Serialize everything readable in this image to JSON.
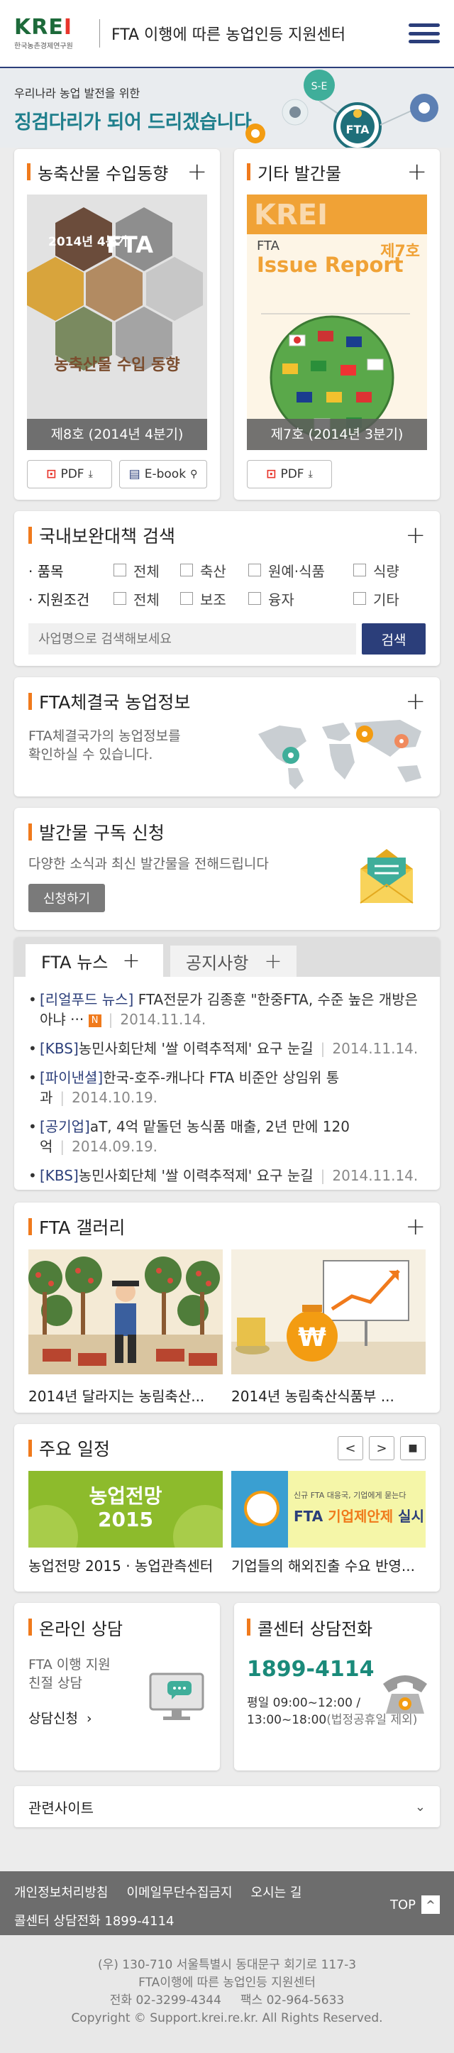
{
  "header": {
    "logo_mark": "KRE",
    "logo_mark_i": "I",
    "logo_sub": "한국농촌경제연구원",
    "title": "FTA 이행에 따른 농업인등 지원센터"
  },
  "hero": {
    "subtitle": "우리나라 농업 발전을 위한",
    "headline": "징검다리가 되어 드리겠습니다.",
    "badge": "FTA"
  },
  "import_trend": {
    "title": "농축산물 수입동향",
    "cover_main": "농축산물 수입 동향",
    "cover_quarter": "2014년 4분기",
    "cover_brand": "FTA",
    "caption": "제8호 (2014년 4분기)",
    "pdf_label": "PDF",
    "ebook_label": "E-book"
  },
  "publications": {
    "title": "기타 발간물",
    "cover_logo": "KREI",
    "cover_fta": "FTA",
    "cover_issue": "Issue Report",
    "cover_num": "제7호",
    "caption": "제7호 (2014년 3분기)",
    "pdf_label": "PDF"
  },
  "search": {
    "title": "국내보완대책 검색",
    "row1_label": "품목",
    "row1_options": [
      "전체",
      "축산",
      "원예·식품",
      "식량"
    ],
    "row2_label": "지원조건",
    "row2_options": [
      "전체",
      "보조",
      "융자",
      "기타"
    ],
    "placeholder": "사업명으로 검색해보세요",
    "button": "검색"
  },
  "fta_info": {
    "title": "FTA체결국 농업정보",
    "desc_line1": "FTA체결국가의 농업정보를",
    "desc_line2": "확인하실 수 있습니다."
  },
  "subscribe": {
    "title": "발간물 구독 신청",
    "desc": "다양한 소식과 최신 발간물을 전해드립니다",
    "button": "신청하기"
  },
  "news": {
    "tab_active": "FTA 뉴스",
    "tab_inactive": "공지사항",
    "new_badge": "N",
    "items": [
      {
        "source": "[리얼푸드 뉴스]",
        "text": " FTA전문가 김종훈 \"한중FTA, 수준 높은 개방은 아냐 ···",
        "date": "2014.11.14."
      },
      {
        "source": "[KBS]",
        "text": "농민사회단체 '쌀 이력추적제' 요구 눈길",
        "date": "2014.11.14."
      },
      {
        "source": "[파이낸셜]",
        "text": "한국-호주-캐나다 FTA 비준안 상임위 통과",
        "date": "2014.10.19."
      },
      {
        "source": "[공기업]",
        "text": "aT, 4억 맡돌던 농식품 매출, 2년 만에 120억",
        "date": "2014.09.19."
      },
      {
        "source": "[KBS]",
        "text": "농민사회단체 '쌀 이력추적제' 요구 눈길",
        "date": "2014.11.14."
      }
    ]
  },
  "gallery": {
    "title": "FTA 갤러리",
    "items": [
      {
        "caption": "2014년 달라지는 농림축산..."
      },
      {
        "caption": "2014년 농림축산식품부 ..."
      }
    ]
  },
  "schedule": {
    "title": "주요 일정",
    "prev": "<",
    "next": ">",
    "stop": "■",
    "banner1_line1": "농업전망",
    "banner1_line2": "2015",
    "banner2_small": "신규 FTA 대응국, 기업에게 묻는다",
    "banner2_main_a": "FTA ",
    "banner2_main_b": "기업제안제",
    "banner2_main_c": " 실시",
    "items": [
      {
        "caption": "농업전망 2015 · 농업관측센터"
      },
      {
        "caption": "기업들의 해외진출 수요 반영..."
      }
    ]
  },
  "consult": {
    "title": "온라인 상담",
    "desc_line1": "FTA 이행 지원",
    "desc_line2": "친절 상담",
    "link": "상담신청",
    "link_arrow": "›"
  },
  "callcenter": {
    "title": "콜센터 상담전화",
    "phone": "1899-4114",
    "hours_line1": "평일 09:00~12:00 /",
    "hours_line2": "13:00~18:00",
    "hours_note": "(법정공휴일 제외)"
  },
  "related": {
    "label": "관련사이트",
    "arrow": "⌄"
  },
  "footer": {
    "links": [
      "개인정보처리방침",
      "이메일무단수집금지",
      "오시는 길"
    ],
    "callcenter": "콜센터 상담전화 1899-4114",
    "top": "TOP",
    "top_arrow": "^",
    "address": "(우) 130-710 서울특별시 동대문구 회기로 117-3",
    "org": "FTA이행에 따른 농업인등 지원센터",
    "contact": "전화 02-3299-4344     팩스 02-964-5633",
    "copyright": "Copyright © Support.krei.re.kr. All Rights Reserved."
  },
  "colors": {
    "navy": "#2b3e7a",
    "orange_accent": "#f07a1c",
    "teal_headline": "#1f7f8c",
    "phone_green": "#1a8a7a"
  }
}
